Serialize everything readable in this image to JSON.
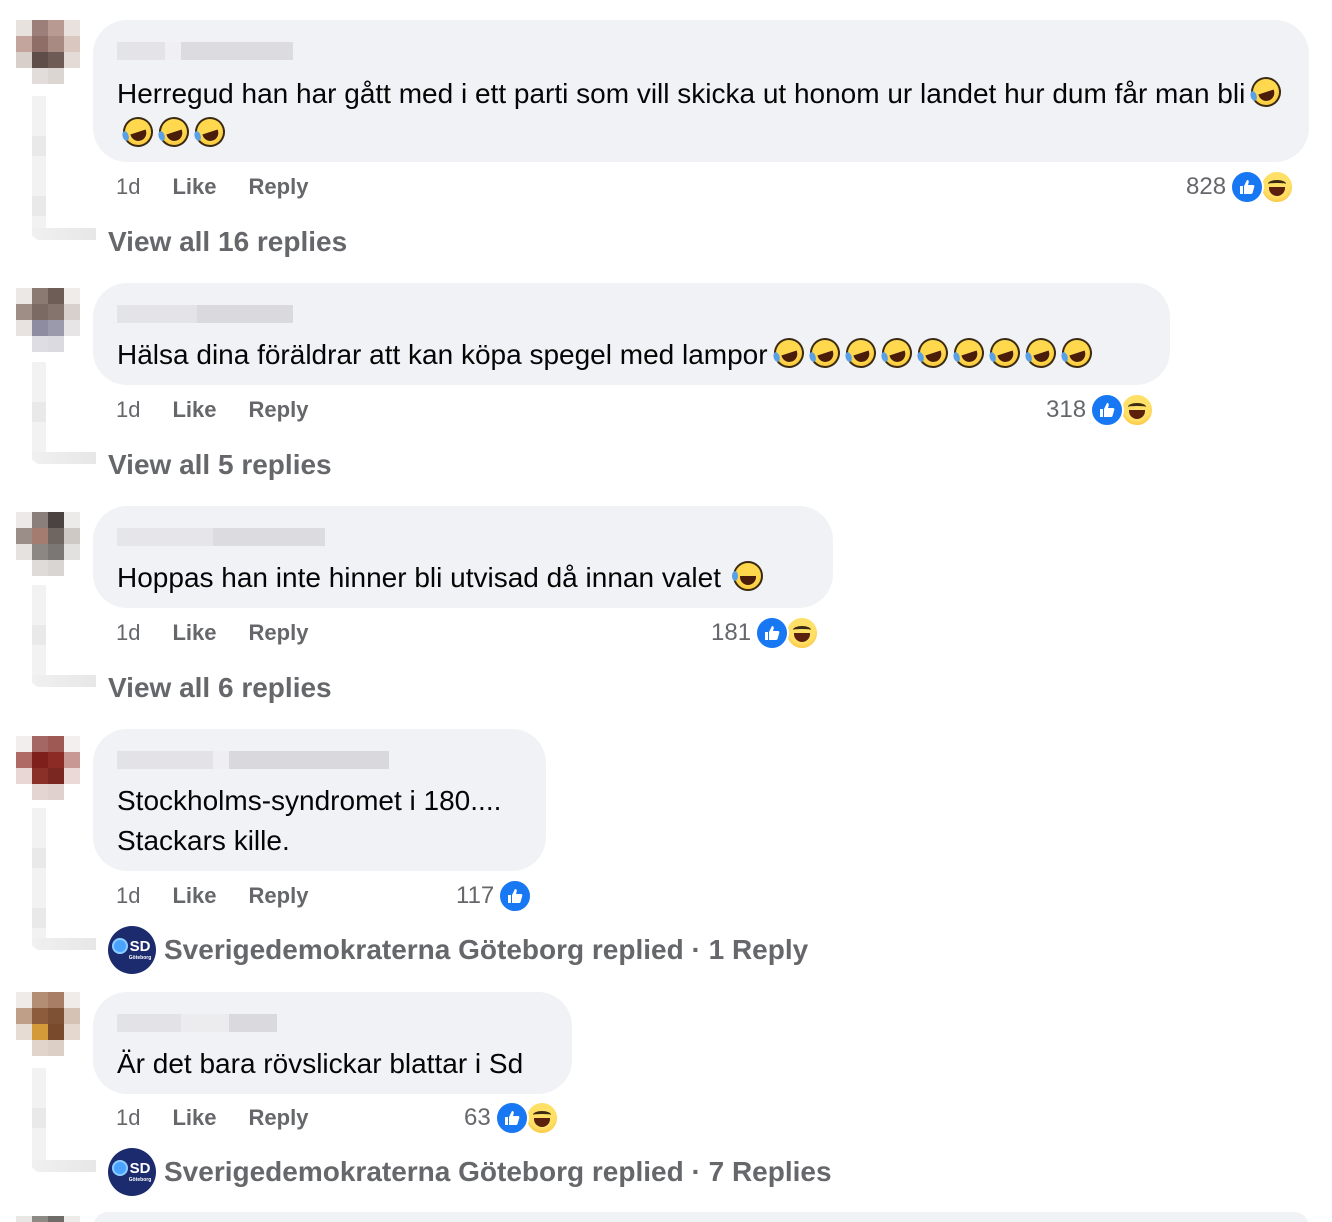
{
  "comments": [
    {
      "text": "Herregud han har gått med i ett parti som vill skicka ut honom ur landet hur dum får man bli",
      "emoji_count": 4,
      "time": "1d",
      "like_label": "Like",
      "reply_label": "Reply",
      "reaction_count": "828",
      "reactions": [
        "like-icon",
        "haha-icon"
      ],
      "footer": "View all 16 replies"
    },
    {
      "text": "Hälsa dina föräldrar att kan köpa spegel med lampor",
      "emoji_count": 9,
      "time": "1d",
      "like_label": "Like",
      "reply_label": "Reply",
      "reaction_count": "318",
      "reactions": [
        "like-icon",
        "haha-icon"
      ],
      "footer": "View all 5 replies"
    },
    {
      "text": "Hoppas han inte hinner bli utvisad då innan valet",
      "emoji_count": 1,
      "time": "1d",
      "like_label": "Like",
      "reply_label": "Reply",
      "reaction_count": "181",
      "reactions": [
        "like-icon",
        "haha-icon"
      ],
      "footer": "View all 6 replies"
    },
    {
      "text_line1": "Stockholms-syndromet i 180....",
      "text_line2": "Stackars kille.",
      "time": "1d",
      "like_label": "Like",
      "reply_label": "Reply",
      "reaction_count": "117",
      "reactions": [
        "like-icon"
      ],
      "footer_page": "Sverigedemokraterna Göteborg replied · 1 Reply"
    },
    {
      "text": "Är det bara rövslickar blattar i Sd",
      "time": "1d",
      "like_label": "Like",
      "reply_label": "Reply",
      "reaction_count": "63",
      "reactions": [
        "like-icon",
        "haha-icon"
      ],
      "footer_page": "Sverigedemokraterna Göteborg replied · 7 Replies"
    }
  ],
  "page_logo": {
    "text": "SD",
    "sub": "Göteborg",
    "color": "#1c2a6e"
  },
  "colors": {
    "bubble": "#f0f2f5",
    "meta": "#65676b",
    "like_blue": "#1877f2"
  }
}
